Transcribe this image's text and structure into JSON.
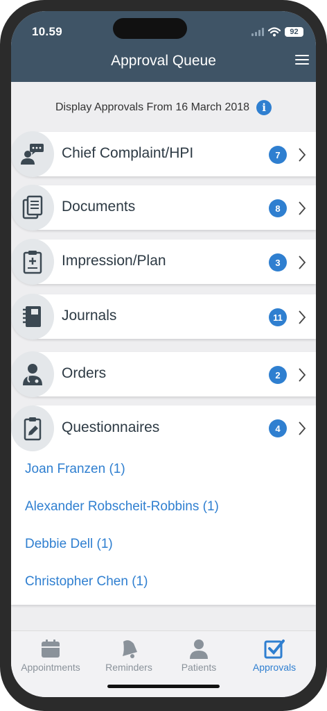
{
  "status": {
    "time": "10.59",
    "battery": "92"
  },
  "header": {
    "title": "Approval Queue"
  },
  "filter": {
    "text": "Display Approvals From 16 March 2018"
  },
  "categories": [
    {
      "label": "Chief Complaint/HPI",
      "count": "7",
      "icon": "chat-person-icon"
    },
    {
      "label": "Documents",
      "count": "8",
      "icon": "documents-icon"
    },
    {
      "label": "Impression/Plan",
      "count": "3",
      "icon": "clipboard-plus-icon"
    },
    {
      "label": "Journals",
      "count": "11",
      "icon": "journal-icon"
    },
    {
      "label": "Orders",
      "count": "2",
      "icon": "doctor-icon"
    },
    {
      "label": "Questionnaires",
      "count": "4",
      "icon": "clipboard-edit-icon"
    }
  ],
  "questionnaire_people": [
    "Joan Franzen (1)",
    "Alexander Robscheit-Robbins (1)",
    "Debbie Dell (1)",
    "Christopher Chen (1)"
  ],
  "tabs": [
    {
      "label": "Appointments",
      "icon": "calendar-icon",
      "active": false
    },
    {
      "label": "Reminders",
      "icon": "bell-icon",
      "active": false
    },
    {
      "label": "Patients",
      "icon": "person-icon",
      "active": false
    },
    {
      "label": "Approvals",
      "icon": "checkbox-icon",
      "active": true
    }
  ],
  "colors": {
    "header": "#3f5466",
    "accent": "#2f7fd0"
  }
}
